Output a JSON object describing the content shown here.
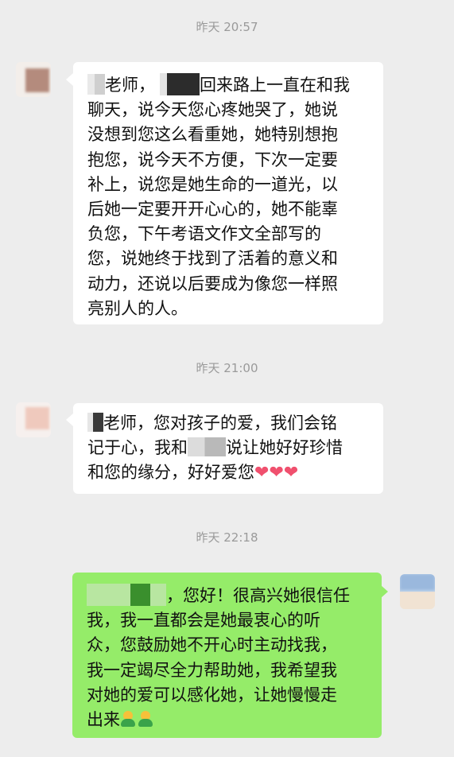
{
  "messages": [
    {
      "time": "昨天 20:57",
      "direction": "incoming",
      "lines": [
        "老师，",
        "回来路上一直在和我",
        "聊天，说今天您心疼她哭了，她说",
        "没想到您这么看重她，她特别想抱",
        "抱您，说今天不方便，下次一定要",
        "补上，说您是她生命的一道光，以",
        "后她一定要开开心心的，她不能辜",
        "负您，下午考语文作文全部写的",
        "您，说她终于找到了活着的意义和",
        "动力，还说以后要成为像您一样照",
        "亮别人的人。"
      ]
    },
    {
      "time": "昨天 21:00",
      "direction": "incoming",
      "lines": [
        "老师，您对孩子的爱，我们会铭",
        "记于心，我和",
        "说让她好好珍惜",
        "和您的缘分，好好爱您"
      ],
      "emoji": [
        "heart-icon",
        "heart-icon",
        "heart-icon"
      ]
    },
    {
      "time": "昨天 22:18",
      "direction": "outgoing",
      "lines": [
        "，您好！很高兴她很信任",
        "我，我一直都会是她最衷心的听",
        "众，您鼓励她不开心时主动找我，",
        "我一定竭尽全力帮助她，我希望我",
        "对她的爱可以感化她，让她慢慢走",
        "出来"
      ],
      "emoji": [
        "person-hug-icon",
        "person-hug-icon"
      ]
    }
  ],
  "colors": {
    "background": "#ededed",
    "incoming_bubble": "#ffffff",
    "outgoing_bubble": "#95ec69",
    "timestamp": "#9a9a9a",
    "text": "#111111",
    "heart": "#f0506e"
  }
}
